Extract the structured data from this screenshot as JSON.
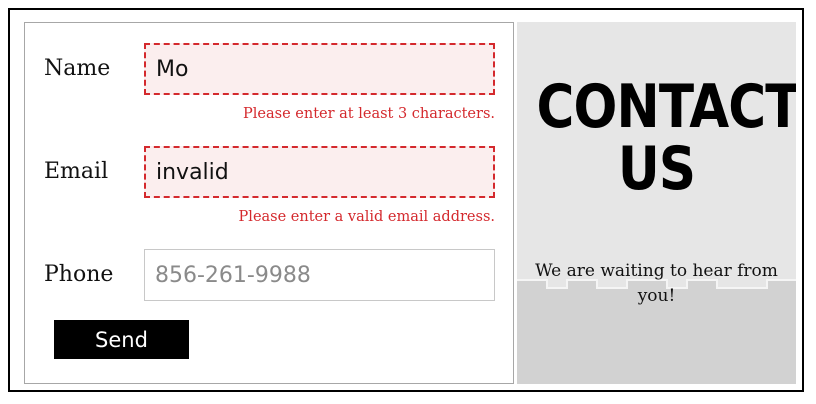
{
  "form": {
    "name": {
      "label": "Name",
      "value": "Mo",
      "error": "Please enter at least 3 characters."
    },
    "email": {
      "label": "Email",
      "value": "invalid",
      "error": "Please enter a valid email address."
    },
    "phone": {
      "label": "Phone",
      "placeholder": "856-261-9988"
    },
    "send_label": "Send"
  },
  "side": {
    "title_line1": "CONTACT",
    "title_line2": "US",
    "tagline": "We are waiting to hear from you!"
  },
  "colors": {
    "error": "#d4292d",
    "invalid_bg": "#fbeeee",
    "panel_bg": "#e6e6e6",
    "button_bg": "#000000"
  }
}
